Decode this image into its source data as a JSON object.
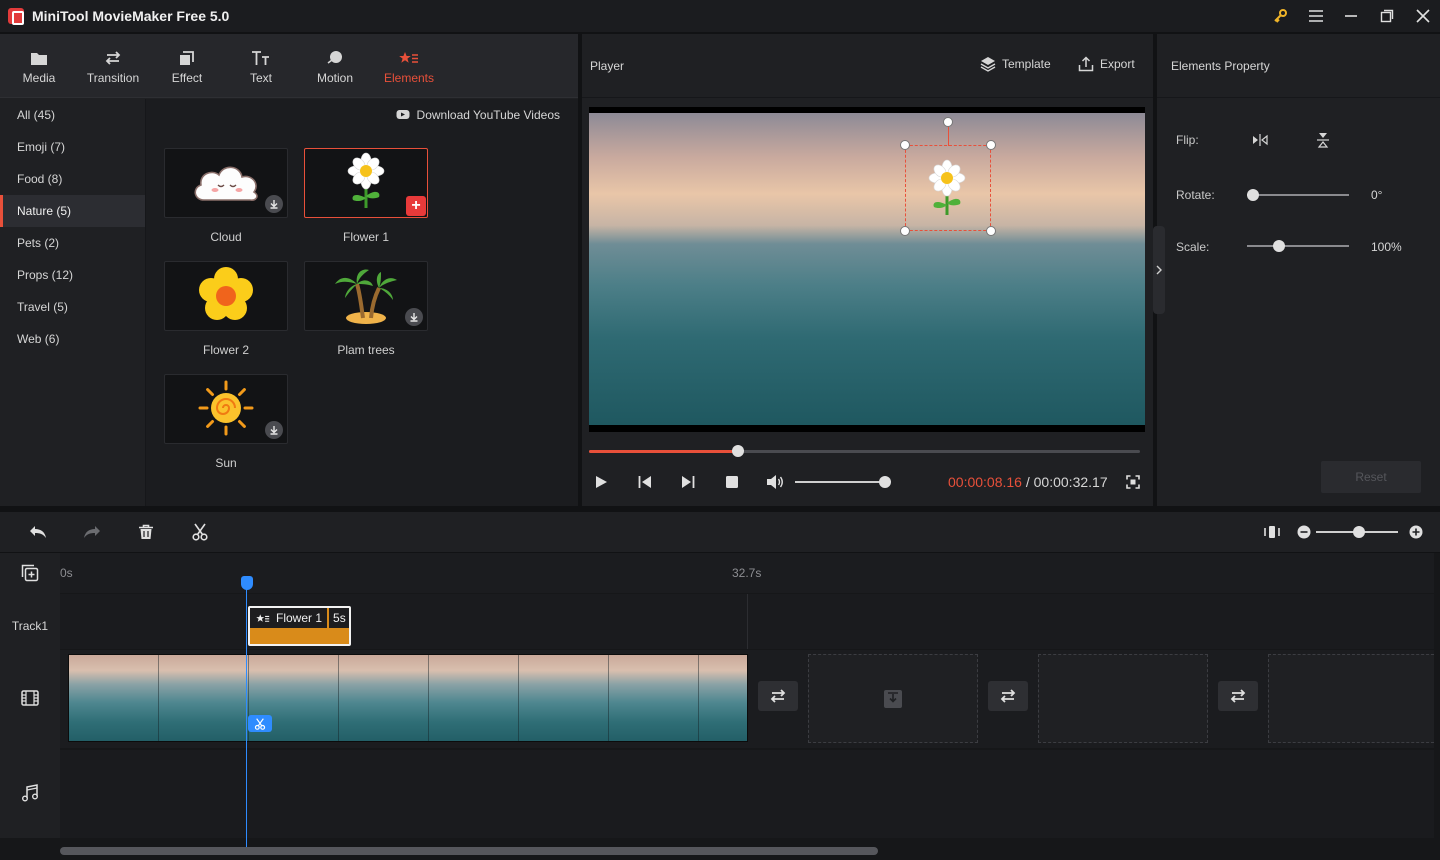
{
  "window": {
    "title": "MiniTool MovieMaker Free 5.0"
  },
  "toolbar_tabs": [
    {
      "label": "Media",
      "icon": "folder-icon"
    },
    {
      "label": "Transition",
      "icon": "swap-arrows-icon"
    },
    {
      "label": "Effect",
      "icon": "effect-icon"
    },
    {
      "label": "Text",
      "icon": "text-icon"
    },
    {
      "label": "Motion",
      "icon": "motion-icon"
    },
    {
      "label": "Elements",
      "icon": "elements-icon",
      "active": true
    }
  ],
  "categories": [
    {
      "label": "All (45)"
    },
    {
      "label": "Emoji (7)"
    },
    {
      "label": "Food (8)"
    },
    {
      "label": "Nature (5)",
      "active": true
    },
    {
      "label": "Pets (2)"
    },
    {
      "label": "Props (12)"
    },
    {
      "label": "Travel (5)"
    },
    {
      "label": "Web (6)"
    }
  ],
  "download_youtube": "Download YouTube Videos",
  "elements": [
    {
      "label": "Cloud",
      "icon": "cloud-icon"
    },
    {
      "label": "Flower 1",
      "icon": "daisy-flower-icon",
      "selected": true
    },
    {
      "label": "Flower 2",
      "icon": "yellow-flower-icon"
    },
    {
      "label": "Plam trees",
      "icon": "palm-trees-icon"
    },
    {
      "label": "Sun",
      "icon": "sun-icon"
    }
  ],
  "player": {
    "title": "Player",
    "template_label": "Template",
    "export_label": "Export",
    "progress": 0.27,
    "volume": 0.95,
    "current_time": "00:00:08.16",
    "separator": " / ",
    "total_time": "00:00:32.17"
  },
  "properties": {
    "title": "Elements Property",
    "flip_label": "Flip:",
    "rotate_label": "Rotate:",
    "rotate_value": "0°",
    "rotate_level": 0.0,
    "scale_label": "Scale:",
    "scale_value": "100%",
    "scale_level": 0.25,
    "reset_label": "Reset"
  },
  "timeline": {
    "ruler_start": "0s",
    "ruler_end": "32.7s",
    "track1_label": "Track1",
    "element_clip_name": "Flower 1",
    "element_clip_duration": "5s",
    "zoom_level": 0.45
  },
  "colors": {
    "accent": "#e8503a",
    "playhead": "#2f8cff",
    "clip": "#d98b1a"
  }
}
